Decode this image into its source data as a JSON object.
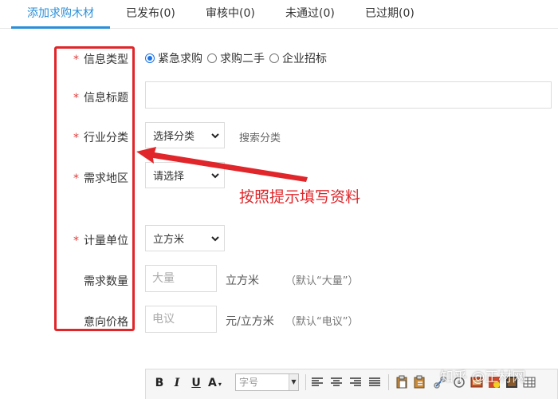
{
  "tabs": [
    {
      "label": "添加求购木材",
      "active": true
    },
    {
      "label": "已发布(0)"
    },
    {
      "label": "审核中(0)"
    },
    {
      "label": "未通过(0)"
    },
    {
      "label": "已过期(0)"
    }
  ],
  "form": {
    "required_mark": "*",
    "info_type": {
      "label": "信息类型",
      "options": [
        "紧急求购",
        "求购二手",
        "企业招标"
      ],
      "selected": "紧急求购"
    },
    "info_title": {
      "label": "信息标题",
      "value": ""
    },
    "industry": {
      "label": "行业分类",
      "select_value": "选择分类",
      "search_link": "搜索分类"
    },
    "region": {
      "label": "需求地区",
      "select_value": "请选择"
    },
    "unit": {
      "label": "计量单位",
      "select_value": "立方米"
    },
    "quantity": {
      "label": "需求数量",
      "placeholder": "大量",
      "unit": "立方米",
      "note": "（默认“大量”）"
    },
    "price": {
      "label": "意向价格",
      "placeholder": "电议",
      "unit": "元/立方米",
      "note": "（默认“电议”）"
    }
  },
  "annotation": {
    "text": "按照提示填写资料",
    "color": "#e0262a"
  },
  "editor_toolbar": {
    "bold": "B",
    "italic": "I",
    "underline": "U",
    "font_color": "A",
    "font_size_placeholder": "字号",
    "icons": [
      "align-left-icon",
      "align-center-icon",
      "align-right-icon",
      "align-justify-icon",
      "paste-icon",
      "paste-text-icon",
      "link-icon",
      "image-icon",
      "media-icon",
      "table-icon"
    ]
  },
  "watermark": "知乎 @正材网",
  "colors": {
    "accent": "#2a8fd8",
    "required": "#e03c3c",
    "annotation": "#e0262a"
  }
}
